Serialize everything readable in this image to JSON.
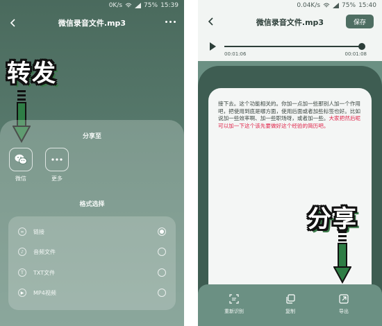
{
  "left": {
    "status": {
      "speed": "0K/s",
      "battery": "75%",
      "time": "15:39"
    },
    "title": "微信录音文件.mp3",
    "annotation": "转发",
    "share_title": "分享至",
    "share_options": [
      {
        "label": "微信",
        "icon": "wechat-icon"
      },
      {
        "label": "更多",
        "icon": "more-icon"
      }
    ],
    "format_title": "格式选择",
    "formats": [
      {
        "label": "链接",
        "icon": "link-icon",
        "selected": true
      },
      {
        "label": "音频文件",
        "icon": "audio-icon",
        "selected": false
      },
      {
        "label": "TXT文件",
        "icon": "txt-icon",
        "selected": false
      },
      {
        "label": "MP4视频",
        "icon": "video-icon",
        "selected": false
      }
    ]
  },
  "right": {
    "status": {
      "speed": "0.04K/s",
      "battery": "75%",
      "time": "15:40"
    },
    "title": "微信录音文件.mp3",
    "save_label": "保存",
    "player": {
      "current": "00:01:06",
      "total": "00:01:08",
      "progress": 0.97
    },
    "doc_text": "接下去。这个功能相关的。你加一点加一些那别人加一个作用吧，把使用到底是哪方面，使用后面或者加些标签也好。比如说加一些效率啊、加一些职场呀，或者加一些。",
    "doc_highlight": "大家把然后呢可以加一下这个该先要做好这个经验的简历吧。",
    "annotation": "分享",
    "actions": [
      {
        "label": "重新识别",
        "icon": "rescan-icon"
      },
      {
        "label": "复制",
        "icon": "copy-icon"
      },
      {
        "label": "导出",
        "icon": "export-icon"
      }
    ]
  },
  "colors": {
    "arrow": "#2e7d45",
    "highlight": "#e0244a",
    "panel": "#3e5d52"
  }
}
